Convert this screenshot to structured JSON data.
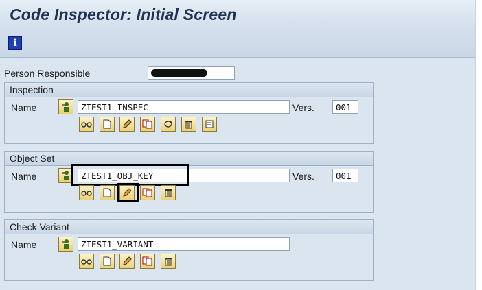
{
  "window": {
    "title": "Code Inspector: Initial Screen"
  },
  "toolbar": {
    "info_icon": "info-icon"
  },
  "person_responsible": {
    "label": "Person Responsible",
    "value": ""
  },
  "inspection": {
    "header": "Inspection",
    "name_label": "Name",
    "name_value": "ZTEST1_INSPEC",
    "vers_label": "Vers.",
    "vers_value": "001",
    "buttons": [
      "glasses-icon",
      "document-icon",
      "pencil-icon",
      "copy-icon",
      "refresh-icon",
      "trash-icon",
      "scroll-icon"
    ]
  },
  "object_set": {
    "header": "Object Set",
    "name_label": "Name",
    "name_value": "ZTEST1_OBJ_KEY",
    "vers_label": "Vers.",
    "vers_value": "001",
    "buttons": [
      "glasses-icon",
      "document-icon",
      "pencil-icon",
      "copy-icon",
      "trash-icon"
    ]
  },
  "check_variant": {
    "header": "Check Variant",
    "name_label": "Name",
    "name_value": "ZTEST1_VARIANT",
    "buttons": [
      "glasses-icon",
      "document-icon",
      "pencil-icon",
      "copy-icon",
      "trash-icon"
    ]
  }
}
